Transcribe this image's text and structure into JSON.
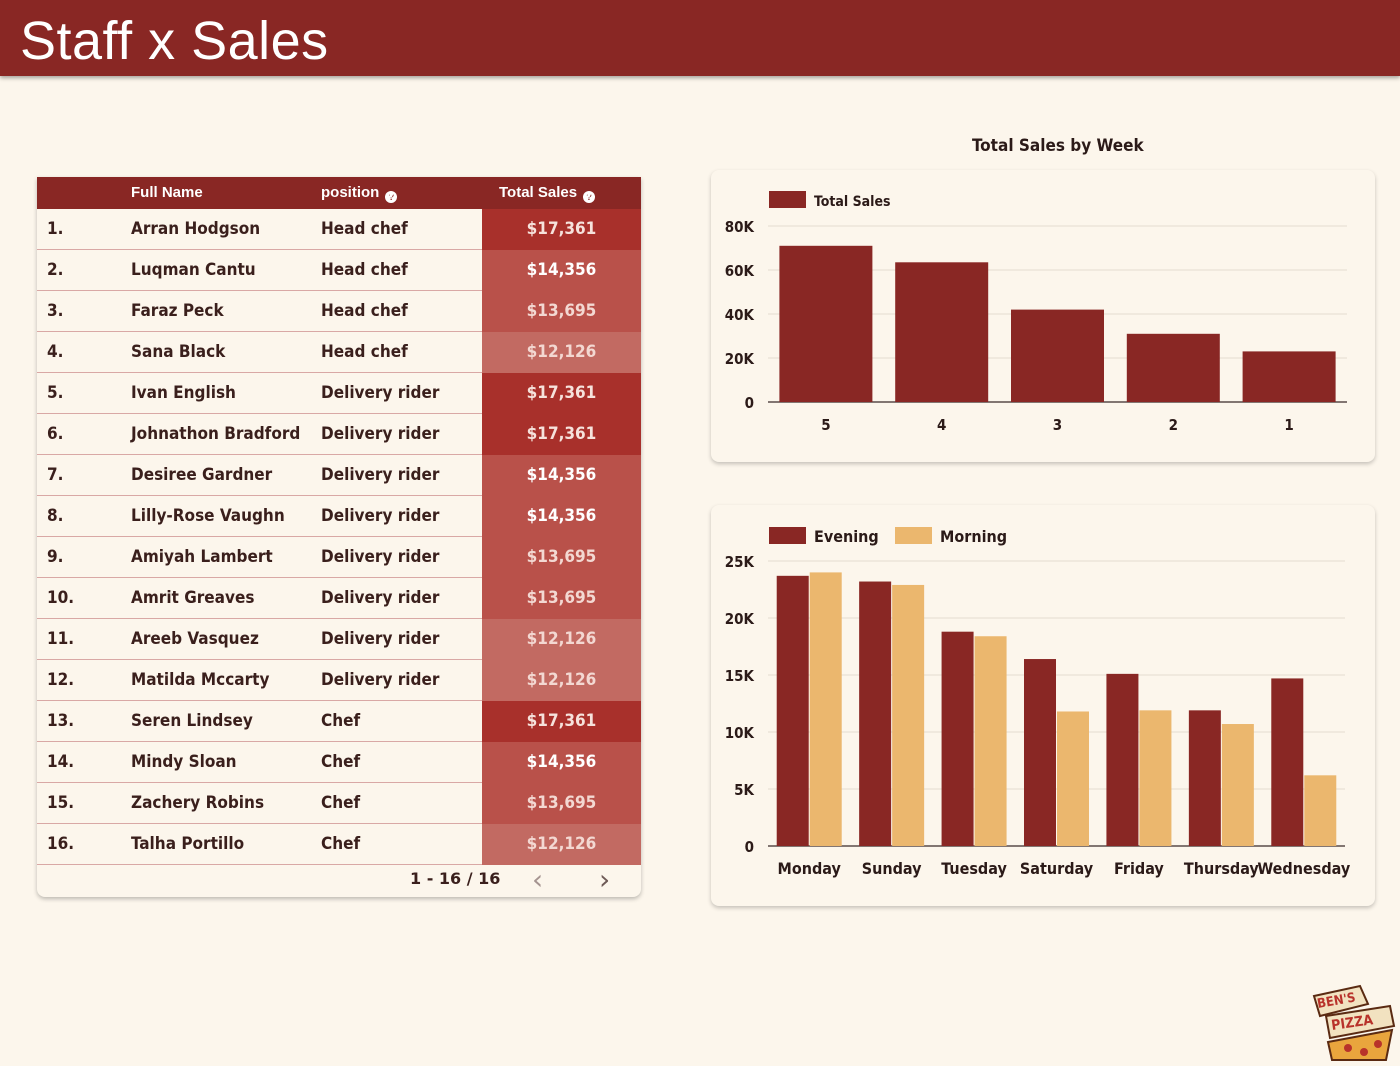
{
  "header": {
    "title": "Staff x Sales"
  },
  "table": {
    "columns": {
      "name": "Full Name",
      "position": "position",
      "sales": "Total Sales"
    },
    "rows": [
      {
        "num": "1.",
        "name": "Arran Hodgson",
        "position": "Head chef",
        "sales": "$17,361",
        "value": 17361
      },
      {
        "num": "2.",
        "name": "Luqman Cantu",
        "position": "Head chef",
        "sales": "$14,356",
        "value": 14356
      },
      {
        "num": "3.",
        "name": "Faraz Peck",
        "position": "Head chef",
        "sales": "$13,695",
        "value": 13695
      },
      {
        "num": "4.",
        "name": "Sana Black",
        "position": "Head chef",
        "sales": "$12,126",
        "value": 12126
      },
      {
        "num": "5.",
        "name": "Ivan English",
        "position": "Delivery rider",
        "sales": "$17,361",
        "value": 17361
      },
      {
        "num": "6.",
        "name": "Johnathon Bradford",
        "position": "Delivery rider",
        "sales": "$17,361",
        "value": 17361
      },
      {
        "num": "7.",
        "name": "Desiree Gardner",
        "position": "Delivery rider",
        "sales": "$14,356",
        "value": 14356
      },
      {
        "num": "8.",
        "name": "Lilly-Rose Vaughn",
        "position": "Delivery rider",
        "sales": "$14,356",
        "value": 14356
      },
      {
        "num": "9.",
        "name": "Amiyah Lambert",
        "position": "Delivery rider",
        "sales": "$13,695",
        "value": 13695
      },
      {
        "num": "10.",
        "name": "Amrit Greaves",
        "position": "Delivery rider",
        "sales": "$13,695",
        "value": 13695
      },
      {
        "num": "11.",
        "name": "Areeb Vasquez",
        "position": "Delivery rider",
        "sales": "$12,126",
        "value": 12126
      },
      {
        "num": "12.",
        "name": "Matilda Mccarty",
        "position": "Delivery rider",
        "sales": "$12,126",
        "value": 12126
      },
      {
        "num": "13.",
        "name": "Seren Lindsey",
        "position": "Chef",
        "sales": "$17,361",
        "value": 17361
      },
      {
        "num": "14.",
        "name": "Mindy Sloan",
        "position": "Chef",
        "sales": "$14,356",
        "value": 14356
      },
      {
        "num": "15.",
        "name": "Zachery Robins",
        "position": "Chef",
        "sales": "$13,695",
        "value": 13695
      },
      {
        "num": "16.",
        "name": "Talha Portillo",
        "position": "Chef",
        "sales": "$12,126",
        "value": 12126
      }
    ],
    "pagination": "1 - 16 / 16"
  },
  "colors": {
    "brand": "#892724",
    "bar_primary": "#892724",
    "bar_secondary": "#ebb76e",
    "sales_high": "#a8302b",
    "sales_mid": "#b9514a",
    "sales_low": "#c26a62",
    "background": "#fcf6ec"
  },
  "logo": {
    "text": "BEN'S PIZZA"
  },
  "chart_data": [
    {
      "type": "bar",
      "title": "Total Sales by Week",
      "categories": [
        "5",
        "4",
        "3",
        "2",
        "1"
      ],
      "series": [
        {
          "name": "Total Sales",
          "values": [
            71000,
            63500,
            42000,
            31000,
            23000
          ]
        }
      ],
      "yticks": [
        "0",
        "20K",
        "40K",
        "60K",
        "80K"
      ],
      "ylim": [
        0,
        80000
      ],
      "legend": "top-left",
      "grid": true
    },
    {
      "type": "bar",
      "title": "",
      "categories": [
        "Monday",
        "Sunday",
        "Tuesday",
        "Saturday",
        "Friday",
        "Thursday",
        "Wednesday"
      ],
      "series": [
        {
          "name": "Evening",
          "values": [
            23700,
            23200,
            18800,
            16400,
            15100,
            11900,
            14700
          ]
        },
        {
          "name": "Morning",
          "values": [
            24000,
            22900,
            18400,
            11800,
            11900,
            10700,
            6200
          ]
        }
      ],
      "yticks": [
        "0",
        "5K",
        "10K",
        "15K",
        "20K",
        "25K"
      ],
      "ylim": [
        0,
        25000
      ],
      "legend": "top-left",
      "grid": true
    }
  ]
}
